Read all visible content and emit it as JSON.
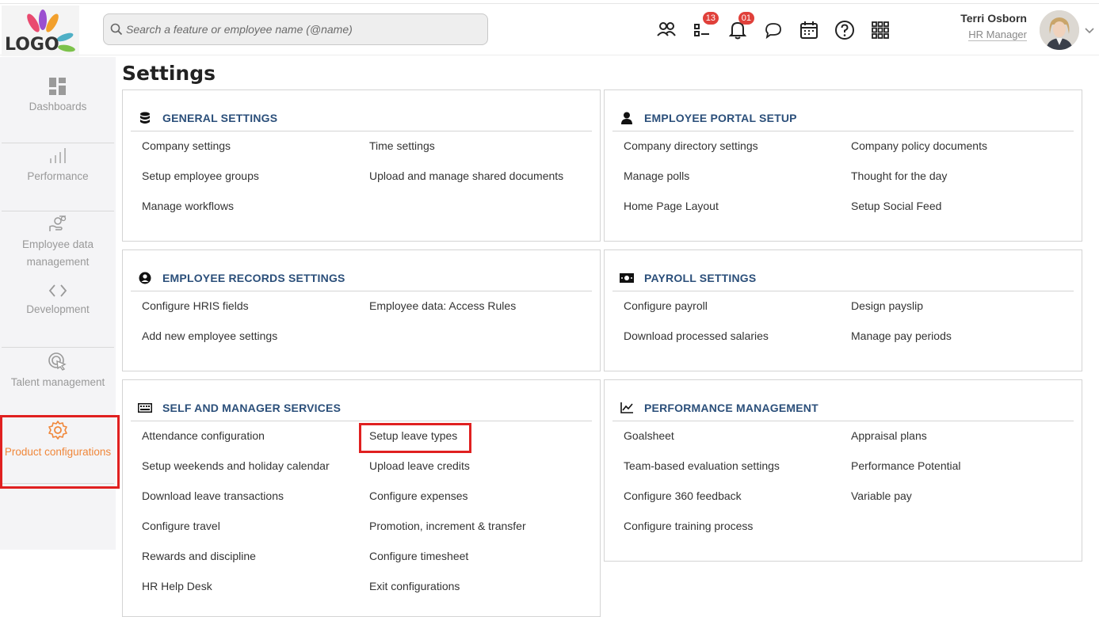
{
  "logo": {
    "text": "LOGO"
  },
  "search": {
    "placeholder": "Search a feature or employee name (@name)"
  },
  "top_icons": [
    {
      "name": "people-icon"
    },
    {
      "name": "tasks-icon",
      "badge": "13"
    },
    {
      "name": "bell-icon",
      "badge": "01"
    },
    {
      "name": "chat-icon"
    },
    {
      "name": "calendar-icon"
    },
    {
      "name": "help-icon"
    },
    {
      "name": "apps-grid-icon"
    }
  ],
  "user": {
    "name": "Terri Osborn",
    "role": "HR Manager"
  },
  "sidebar": {
    "items": [
      {
        "label": "Dashboards",
        "icon": "dashboard-icon"
      },
      {
        "label": "Performance",
        "icon": "bar-chart-icon"
      },
      {
        "label": "Employee data management",
        "icon": "employee-data-icon"
      },
      {
        "label": "Development",
        "icon": "code-icon"
      },
      {
        "label": "Talent management",
        "icon": "target-icon"
      },
      {
        "label": "Product configurations",
        "icon": "gear-icon",
        "active": true
      }
    ]
  },
  "page": {
    "title": "Settings"
  },
  "colors": {
    "accent": "#f0873a",
    "heading": "#2b4f7a",
    "highlight": "#e02020",
    "badge": "#e0403a"
  },
  "cards": {
    "general": {
      "title": "GENERAL SETTINGS",
      "links": [
        "Company settings",
        "Time settings",
        "Setup employee groups",
        "Upload and manage shared documents",
        "Manage workflows"
      ]
    },
    "portal": {
      "title": "EMPLOYEE PORTAL SETUP",
      "links": [
        "Company directory settings",
        "Company policy documents",
        "Manage polls",
        "Thought for the day",
        "Home Page Layout",
        "Setup Social Feed"
      ]
    },
    "records": {
      "title": "EMPLOYEE RECORDS SETTINGS",
      "links": [
        "Configure HRIS fields",
        "Employee data: Access Rules",
        "Add new employee settings"
      ]
    },
    "payroll": {
      "title": "PAYROLL SETTINGS",
      "links": [
        "Configure payroll",
        "Design payslip",
        "Download processed salaries",
        "Manage pay periods"
      ]
    },
    "services": {
      "title": "SELF AND MANAGER SERVICES",
      "links": [
        "Attendance configuration",
        "Setup leave types",
        "Setup weekends and holiday calendar",
        "Upload leave credits",
        "Download leave transactions",
        "Configure expenses",
        "Configure travel",
        "Promotion, increment & transfer",
        "Rewards and discipline",
        "Configure timesheet",
        "HR Help Desk",
        "Exit configurations"
      ]
    },
    "performance": {
      "title": "PERFORMANCE MANAGEMENT",
      "links": [
        "Goalsheet",
        "Appraisal plans",
        "Team-based evaluation settings",
        "Performance Potential",
        "Configure 360 feedback",
        "Variable pay",
        "Configure training process"
      ]
    }
  }
}
